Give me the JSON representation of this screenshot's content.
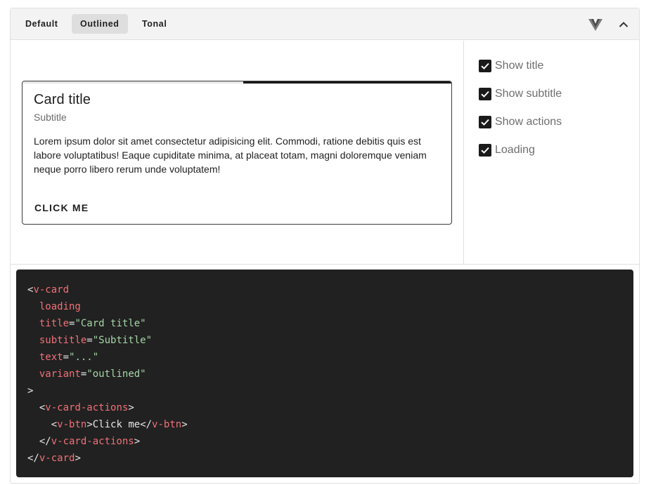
{
  "tabs": [
    {
      "label": "Default",
      "active": false
    },
    {
      "label": "Outlined",
      "active": true
    },
    {
      "label": "Tonal",
      "active": false
    }
  ],
  "toolbar_icons": [
    "vuetify-logo-icon",
    "chevron-up-icon"
  ],
  "card": {
    "title": "Card title",
    "subtitle": "Subtitle",
    "text": "Lorem ipsum dolor sit amet consectetur adipisicing elit. Commodi, ratione debitis quis est labore voluptatibus! Eaque cupiditate minima, at placeat totam, magni doloremque veniam neque porro libero rerum unde voluptatem!",
    "action_label": "Click me",
    "loading": true
  },
  "options": [
    {
      "label": "Show title",
      "checked": true
    },
    {
      "label": "Show subtitle",
      "checked": true
    },
    {
      "label": "Show actions",
      "checked": true
    },
    {
      "label": "Loading",
      "checked": true
    }
  ],
  "code": {
    "open_tag": "v-card",
    "attr_loading": "loading",
    "attr_title": "title",
    "val_title": "\"Card title\"",
    "attr_subtitle": "subtitle",
    "val_subtitle": "\"Subtitle\"",
    "attr_text": "text",
    "val_text": "\"...\"",
    "attr_variant": "variant",
    "val_variant": "\"outlined\"",
    "actions_tag": "v-card-actions",
    "btn_tag": "v-btn",
    "btn_text": "Click me"
  },
  "colors": {
    "code_bg": "#212121",
    "code_tag": "#f07178",
    "code_string": "#a5d6a7",
    "checkbox": "#1a1a1a"
  }
}
